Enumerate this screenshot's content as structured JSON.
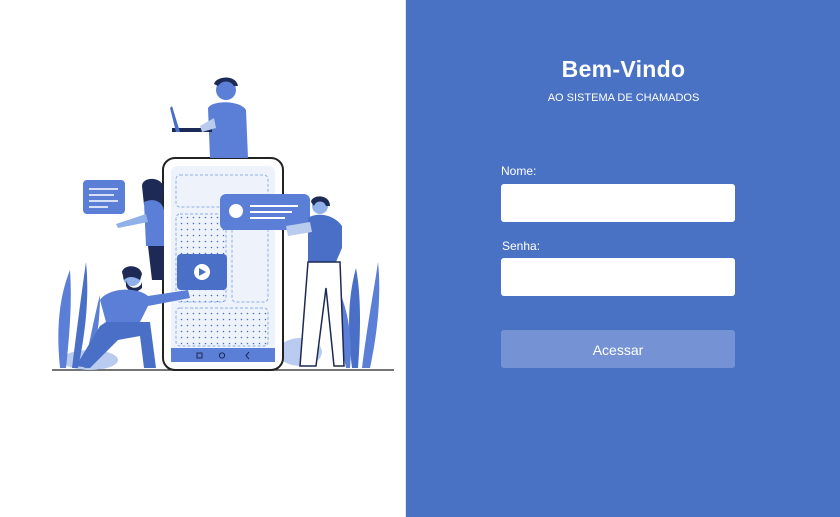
{
  "welcome": {
    "title": "Bem-Vindo",
    "subtitle": "AO SISTEMA DE CHAMADOS"
  },
  "form": {
    "name_label": "Nome:",
    "name_value": "",
    "password_label": "Senha:",
    "password_value": "",
    "submit_label": "Acessar"
  },
  "colors": {
    "panel": "#4a72c4",
    "button": "#7592d4",
    "illustration_accent": "#5b7fd6"
  }
}
